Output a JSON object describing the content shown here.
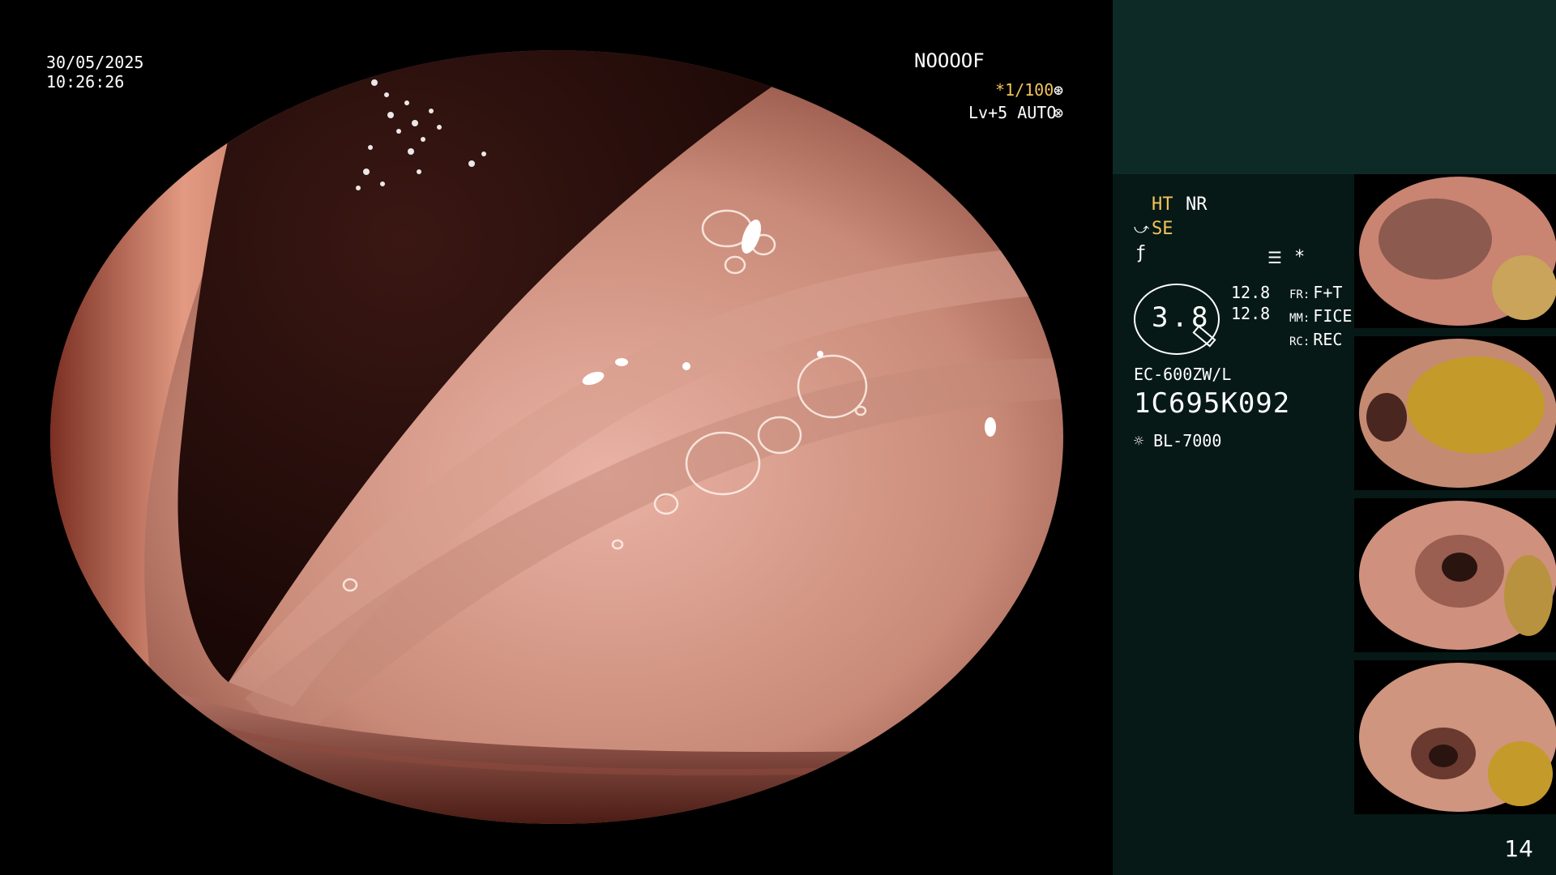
{
  "osd": {
    "date": "30/05/2025",
    "time": "10:26:26",
    "patient_id": "NOOOOF",
    "shutter": "*1/100",
    "light_level": "Lv+5 AUTO"
  },
  "settings": {
    "ht": "HT",
    "nr": "NR",
    "se": "SE",
    "zoom_value": "3.8",
    "mag_1": "12.8",
    "mag_2": "12.8",
    "fr_label": "FR:",
    "fr_value": "F+T",
    "mm_label": "MM:",
    "mm_value": "FICE",
    "rc_label": "RC:",
    "rc_value": "REC",
    "scope_model": "EC-600ZW/L",
    "serial": "1C695K092",
    "light_source": "BL-7000"
  },
  "page": {
    "number": "14"
  },
  "colors": {
    "accent_yellow": "#f2c45a",
    "panel_dark": "#061916",
    "panel_top": "#0d2a26"
  }
}
